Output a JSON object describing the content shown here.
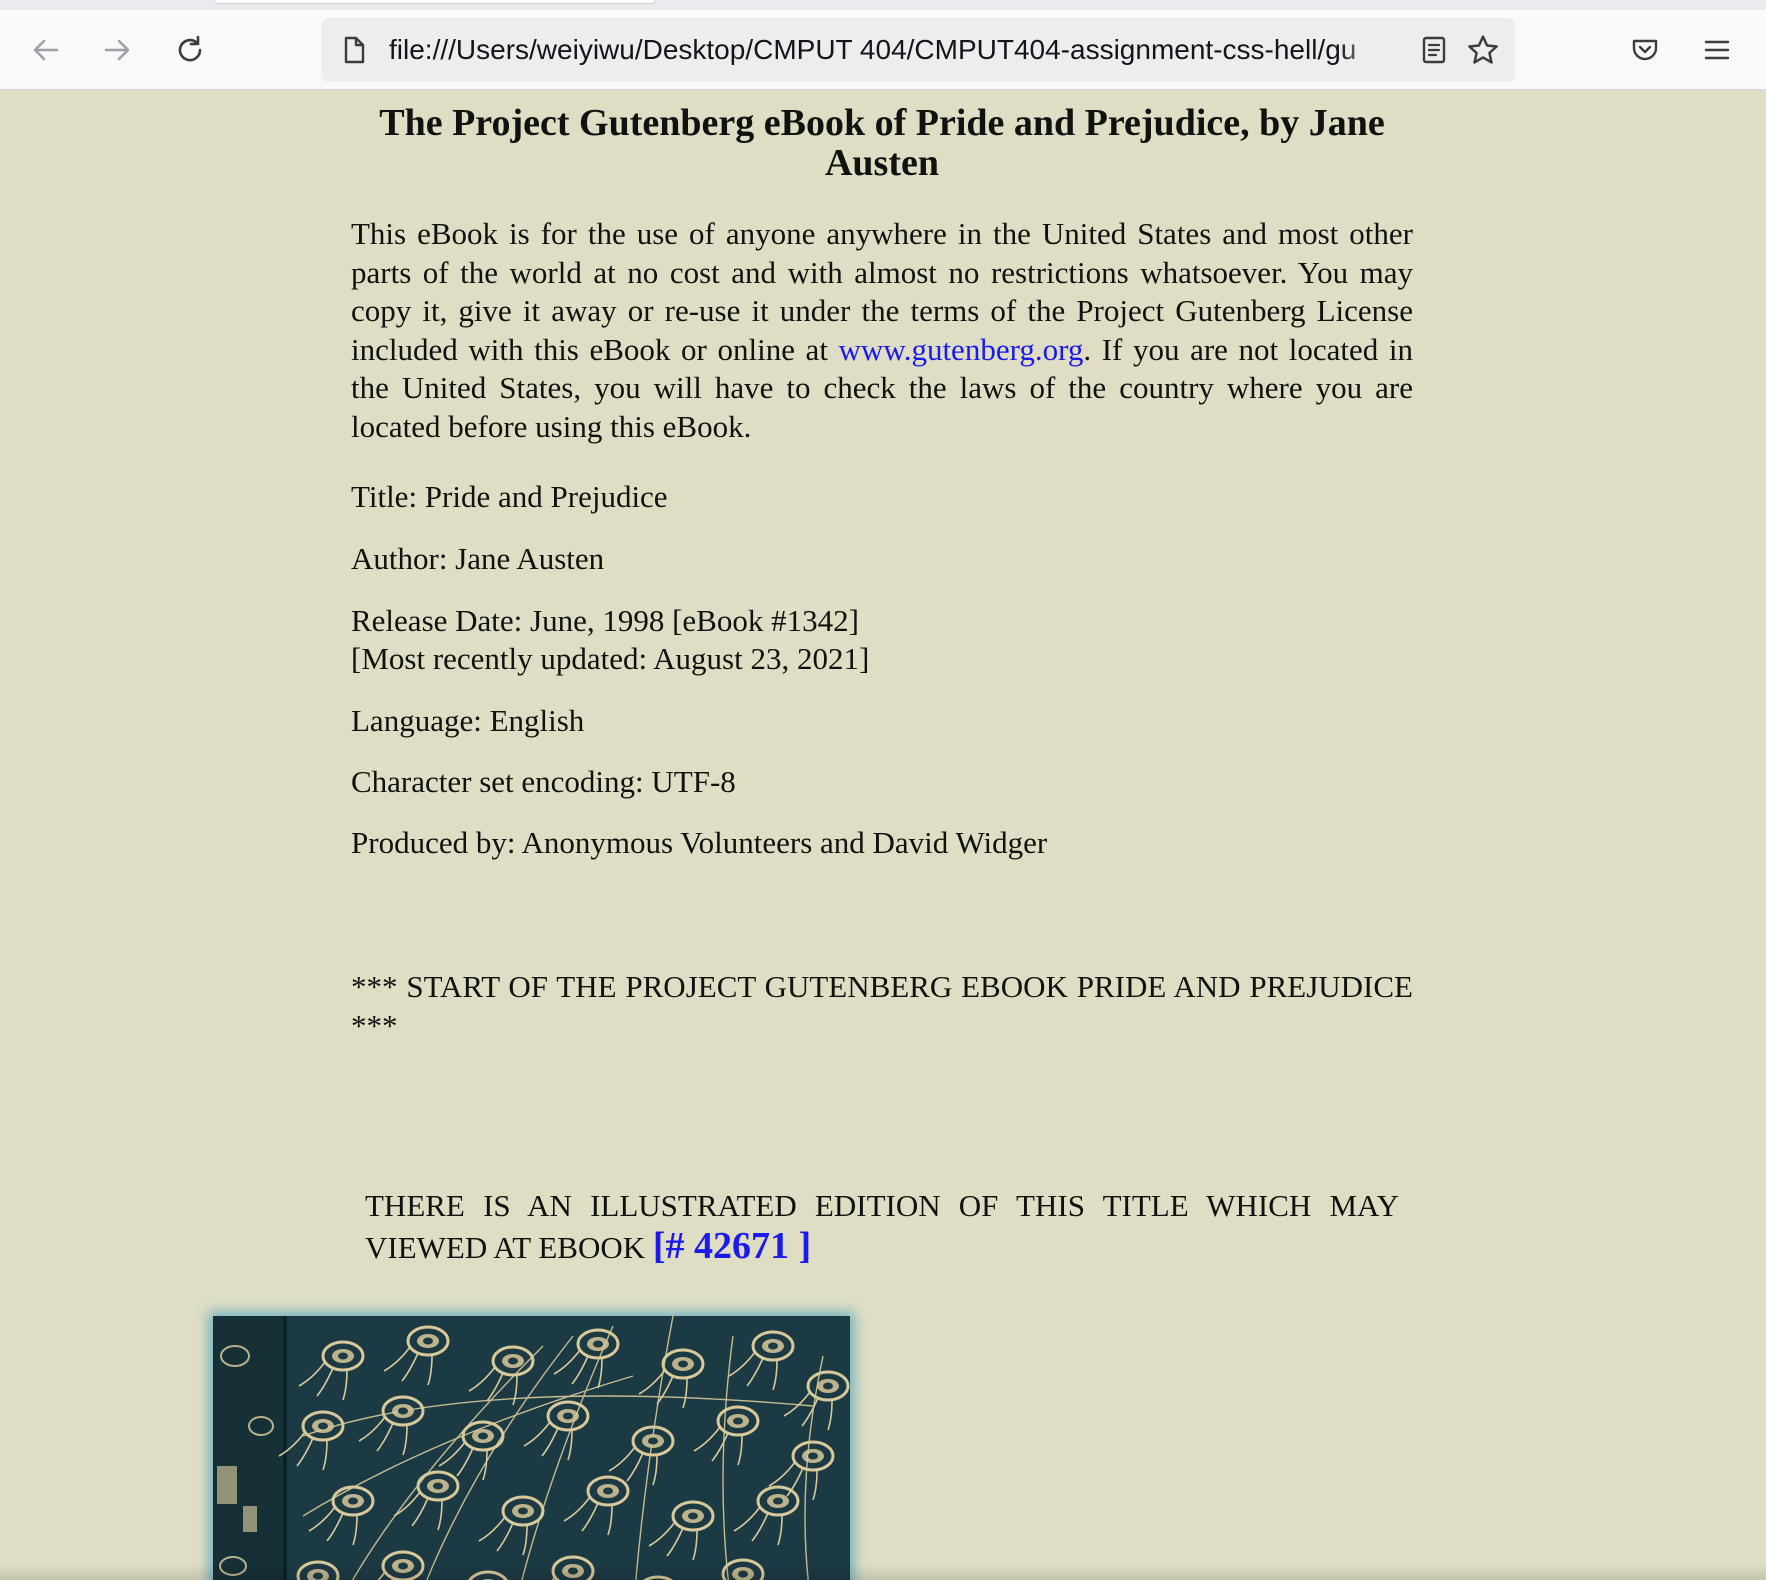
{
  "browser": {
    "url": "file:///Users/weiyiwu/Desktop/CMPUT 404/CMPUT404-assignment-css-hell/gu",
    "icons": {
      "back": "arrow-left-icon",
      "forward": "arrow-right-icon",
      "reload": "reload-icon",
      "page": "document-icon",
      "reader": "reader-view-icon",
      "bookmark": "star-icon",
      "pocket": "pocket-icon",
      "menu": "hamburger-menu-icon"
    }
  },
  "page": {
    "title": "The Project Gutenberg eBook of Pride and Prejudice, by Jane Austen",
    "intro_before_link": "This eBook is for the use of anyone anywhere in the United States and most other parts of the world at no cost and with almost no restrictions whatsoever. You may copy it, give it away or re-use it under the terms of the Project Gutenberg License included with this eBook or online at ",
    "intro_link": "www.gutenberg.org",
    "intro_after_link": ". If you are not located in the United States, you will have to check the laws of the country where you are located before using this eBook.",
    "meta": {
      "title": "Title: Pride and Prejudice",
      "author": "Author: Jane Austen",
      "release_date": "Release Date: June, 1998 [eBook #1342]",
      "updated": "[Most recently updated: August 23, 2021]",
      "language": "Language: English",
      "encoding": "Character set encoding: UTF-8",
      "produced_by": "Produced by: Anonymous Volunteers and David Widger"
    },
    "start_marker": "*** START OF THE PROJECT GUTENBERG EBOOK PRIDE AND PREJUDICE ***",
    "illustrated_text": "THERE IS AN ILLUSTRATED EDITION OF THIS TITLE WHICH MAY VIEWED AT EBOOK ",
    "illustrated_link": "[# 42671 ]"
  },
  "colors": {
    "page_background": "#dfdec4",
    "link": "#1a1aee",
    "cover_glow": "#46a0be",
    "cover_dark": "#1c3a44",
    "cover_gold": "#d8c99a"
  }
}
